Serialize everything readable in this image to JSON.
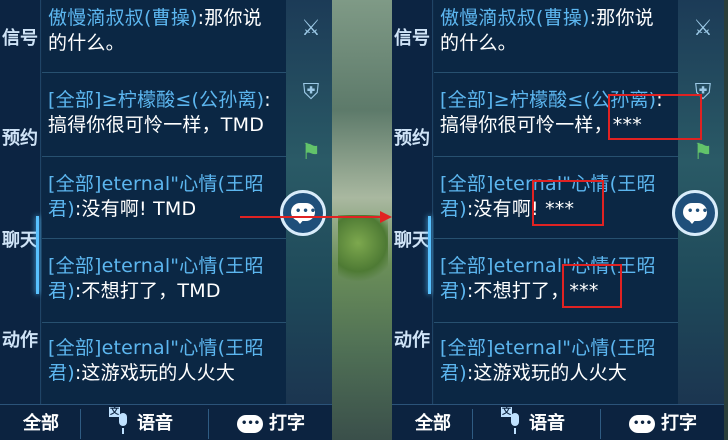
{
  "tabs": [
    "信号",
    "预约",
    "聊天",
    "动作"
  ],
  "active_tab": "聊天",
  "left_panel": {
    "messages": [
      {
        "sender": "傲慢滴叔叔(曹操)",
        "text": ":那你说的什么。"
      },
      {
        "sender": "[全部]≥柠檬酸≤(公孙离)",
        "text": ":搞得你很可怜一样，TMD"
      },
      {
        "sender": "[全部]eternal\"心情(王昭君)",
        "text": ":没有啊! TMD"
      },
      {
        "sender": "[全部]eternal\"心情(王昭君)",
        "text": ":不想打了，TMD"
      },
      {
        "sender": "[全部]eternal\"心情(王昭君)",
        "text": ":这游戏玩的人火大"
      }
    ]
  },
  "right_panel": {
    "messages": [
      {
        "sender": "傲慢滴叔叔(曹操)",
        "text": ":那你说的什么。"
      },
      {
        "sender": "[全部]≥柠檬酸≤(公孙离)",
        "text": ":搞得你很可怜一样，***"
      },
      {
        "sender": "[全部]eternal\"心情(王昭君)",
        "text": ":没有啊! ***"
      },
      {
        "sender": "[全部]eternal\"心情(王昭君)",
        "text": ":不想打了，***"
      },
      {
        "sender": "[全部]eternal\"心情(王昭君)",
        "text": ":这游戏玩的人火大"
      }
    ]
  },
  "bottom_bar": {
    "all_label": "全部",
    "voice_label": "语音",
    "voice_badge": "文",
    "type_label": "打字"
  },
  "colors": {
    "sender": "#5cb6ef",
    "message_text": "#ffffff",
    "highlight": "#e02222",
    "panel_bg": "#0b2744"
  },
  "icons": [
    "sword-icon",
    "shield-icon",
    "flag-icon",
    "chat-bubble-icon",
    "microphone-icon",
    "keyboard-bubble-icon"
  ]
}
